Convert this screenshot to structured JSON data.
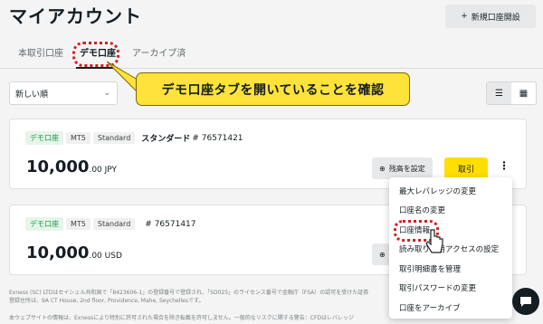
{
  "page": {
    "title": "マイアカウント"
  },
  "header": {
    "new_account_label": "新規口座開設"
  },
  "tabs": [
    {
      "label": "本取引口座"
    },
    {
      "label": "デモ口座"
    },
    {
      "label": "アーカイブ済"
    }
  ],
  "filter": {
    "sort_value": "新しい順"
  },
  "callout": {
    "text": "デモ口座タブを開いていることを確認"
  },
  "accounts": [
    {
      "type_badge": "デモ口座",
      "platform_badge": "MT5",
      "kind_badge": "Standard",
      "name": "スタンダード",
      "number": "# 76571421",
      "balance_main": "10,000",
      "balance_sub": ".00 JPY",
      "set_balance_label": "残高を設定",
      "trade_label": "取引"
    },
    {
      "type_badge": "デモ口座",
      "platform_badge": "MT5",
      "kind_badge": "Standard",
      "name": "",
      "number": "# 76571417",
      "balance_main": "10,000",
      "balance_sub": ".00 USD"
    }
  ],
  "menu": {
    "items": [
      "最大レバレッジの変更",
      "口座名の変更",
      "口座情報",
      "読み取り専用アクセスの設定",
      "取引明細書を管理",
      "取引パスワードの変更",
      "口座をアーカイブ"
    ],
    "highlighted": "口座情報"
  },
  "footer": {
    "line1": "Exness (SC) LTDはセイシェル共和国で「8423606-1」の登録番号で登録され、「SD025」のライセンス番号で金融庁（FSA）の認可を受けた証券",
    "line2": "登録住所は、9A CT House, 2nd floor, Providence, Mahe, Seychellesです。",
    "line3": "本ウェブサイトの情報は、Exnessにより特別に許可された場合を除き転載を許可しません。一般的なリスクに関する警告：CFDはレバレッジ"
  },
  "colors": {
    "accent_yellow": "#ffde02",
    "callout_yellow": "#ffe23a",
    "highlight_red": "#d21f1f",
    "demo_green": "#1a9a4a"
  },
  "icons": [
    "plus-icon",
    "chevron-down-icon",
    "list-view-icon",
    "grid-view-icon",
    "settings-circle-icon",
    "kebab-menu-icon",
    "chat-icon",
    "pointer-cursor-icon"
  ]
}
